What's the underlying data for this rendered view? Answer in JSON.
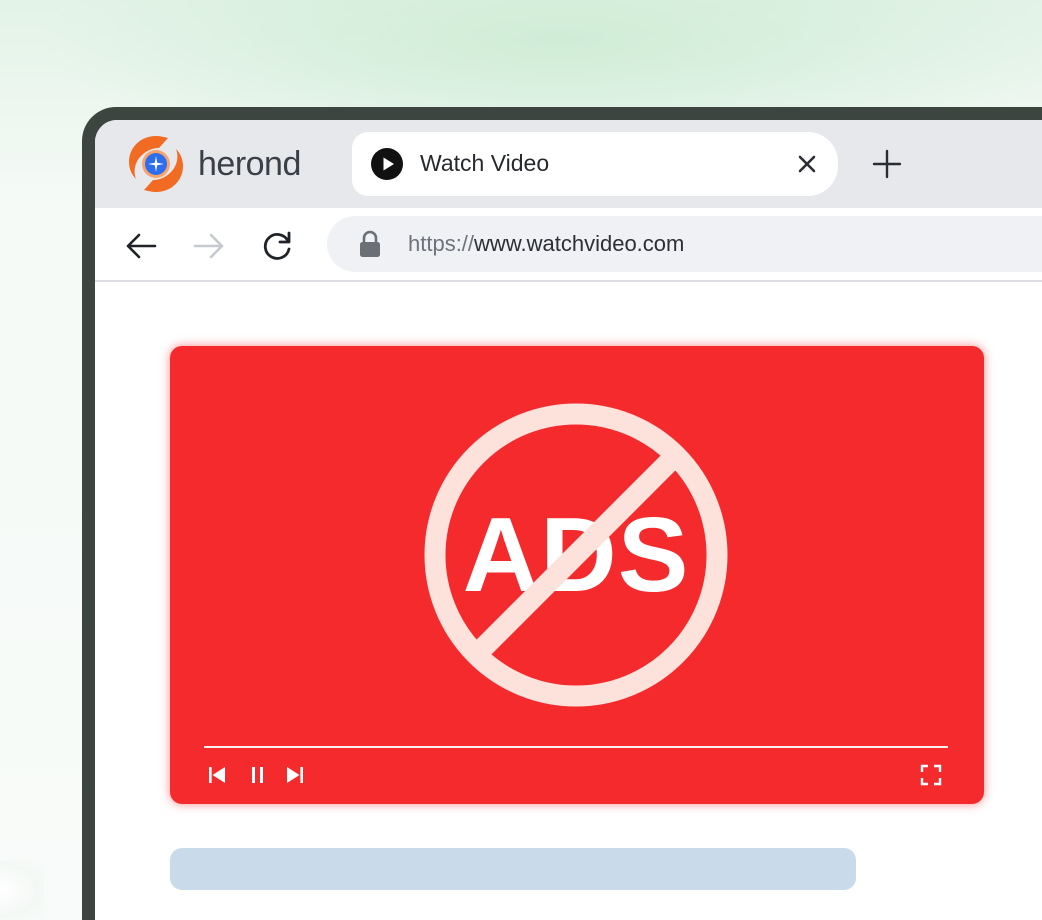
{
  "colors": {
    "video_background": "#f42a2d",
    "sign_color": "#fde2dc",
    "brand_orange": "#f26b22",
    "brand_blue": "#2d6df0",
    "skeleton": "#c9dbea",
    "frame": "#3d4540"
  },
  "brand": {
    "name": "herond",
    "logo_icon": "herond-logo-icon"
  },
  "tab": {
    "favicon_icon": "play-icon",
    "title": "Watch Video",
    "close_icon": "close-icon"
  },
  "toolbar": {
    "new_tab_icon": "plus-icon",
    "back_icon": "arrow-left-icon",
    "forward_icon": "arrow-right-icon",
    "reload_icon": "reload-icon"
  },
  "address_bar": {
    "lock_icon": "lock-icon",
    "url_scheme": "https://",
    "url_host": "www.watchvideo.com"
  },
  "video": {
    "overlay_text": "ADS",
    "sign_icon": "no-sign-icon",
    "controls": {
      "prev_icon": "skip-back-icon",
      "pause_icon": "pause-icon",
      "next_icon": "skip-forward-icon",
      "fullscreen_icon": "fullscreen-icon"
    }
  }
}
